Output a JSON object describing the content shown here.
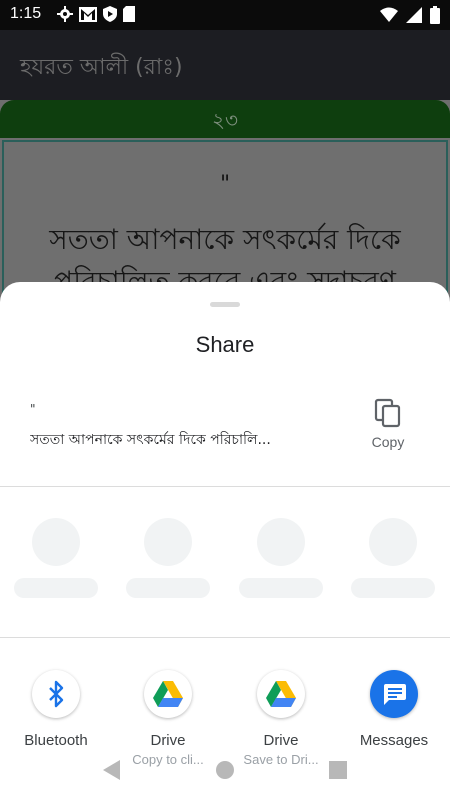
{
  "status_bar": {
    "time": "1:15",
    "left_icons": [
      "settings-icon",
      "gmail-icon",
      "shield-icon",
      "sd-card-icon"
    ],
    "right_icons": [
      "wifi-icon",
      "signal-icon",
      "battery-icon"
    ]
  },
  "app": {
    "title": "হযরত আলী (রাঃ)",
    "number": "২৩",
    "quote_mark": "\"",
    "quote_lines": [
      "সততা আপনাকে সৎকর্মের দিকে",
      "পরিচালিত করবে এবং সদাচরণ"
    ]
  },
  "share_sheet": {
    "title": "Share",
    "preview_quote": "\"",
    "preview_text": "সততা আপনাকে সৎকর্মের দিকে পরিচালি...",
    "copy_label": "Copy",
    "apps": [
      {
        "label": "Bluetooth",
        "sublabel": "",
        "icon": "bluetooth-icon"
      },
      {
        "label": "Drive",
        "sublabel": "Copy to cli...",
        "icon": "google-drive-icon"
      },
      {
        "label": "Drive",
        "sublabel": "Save to Dri...",
        "icon": "google-drive-icon"
      },
      {
        "label": "Messages",
        "sublabel": "",
        "icon": "messages-icon"
      }
    ]
  },
  "colors": {
    "accent_green": "#0e3e0e",
    "messages_blue": "#1a73e8",
    "bluetooth_blue": "#1a73e8"
  }
}
